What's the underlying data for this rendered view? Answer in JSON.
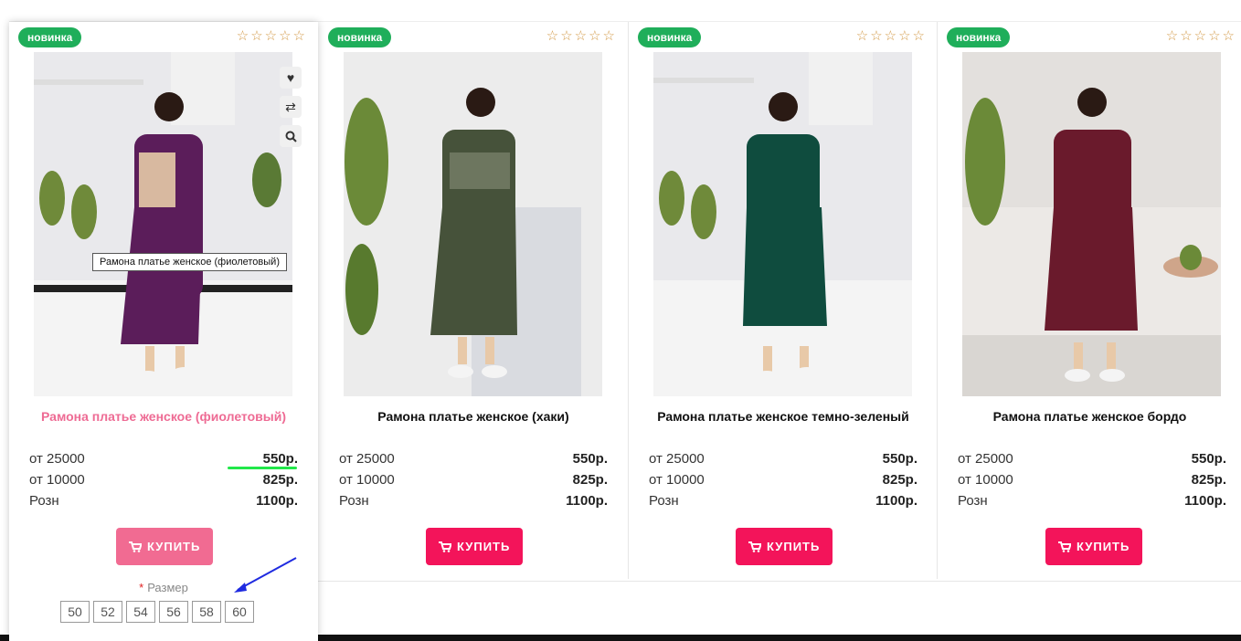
{
  "products": [
    {
      "badge": "новинка",
      "stars": "☆☆☆☆☆",
      "title": "Рамона платье женское (фиолетовый)",
      "dress_color": "#5b1d5a",
      "tooltip": "Рамона платье женское (фиолетовый)",
      "prices": [
        {
          "label": "от 25000",
          "value": "550р."
        },
        {
          "label": "от 10000",
          "value": "825р."
        },
        {
          "label": "Розн",
          "value": "1100р."
        }
      ],
      "buy_label": "КУПИТЬ",
      "size_label": "Размер",
      "size_required": "*",
      "sizes": [
        "50",
        "52",
        "54",
        "56",
        "58",
        "60"
      ]
    },
    {
      "badge": "новинка",
      "stars": "☆☆☆☆☆",
      "title": "Рамона платье женское (хаки)",
      "dress_color": "#46523a",
      "prices": [
        {
          "label": "от 25000",
          "value": "550р."
        },
        {
          "label": "от 10000",
          "value": "825р."
        },
        {
          "label": "Розн",
          "value": "1100р."
        }
      ],
      "buy_label": "КУПИТЬ"
    },
    {
      "badge": "новинка",
      "stars": "☆☆☆☆☆",
      "title": "Рамона платье женское темно-зеленый",
      "dress_color": "#0f4c3e",
      "prices": [
        {
          "label": "от 25000",
          "value": "550р."
        },
        {
          "label": "от 10000",
          "value": "825р."
        },
        {
          "label": "Розн",
          "value": "1100р."
        }
      ],
      "buy_label": "КУПИТЬ"
    },
    {
      "badge": "новинка",
      "stars": "☆☆☆☆☆",
      "title": "Рамона платье женское бордо",
      "dress_color": "#6a1a2c",
      "prices": [
        {
          "label": "от 25000",
          "value": "550р."
        },
        {
          "label": "от 10000",
          "value": "825р."
        },
        {
          "label": "Розн",
          "value": "1100р."
        }
      ],
      "buy_label": "КУПИТЬ"
    }
  ],
  "icons": {
    "wishlist": "heart-icon",
    "compare": "compare-icon",
    "quick_view": "search-icon",
    "cart": "cart-icon"
  },
  "colors": {
    "badge": "#1fae5a",
    "buy": "#f3145a",
    "buy_hover": "#f16b92",
    "title_hover": "#ee6b94",
    "star": "#d39a48"
  }
}
